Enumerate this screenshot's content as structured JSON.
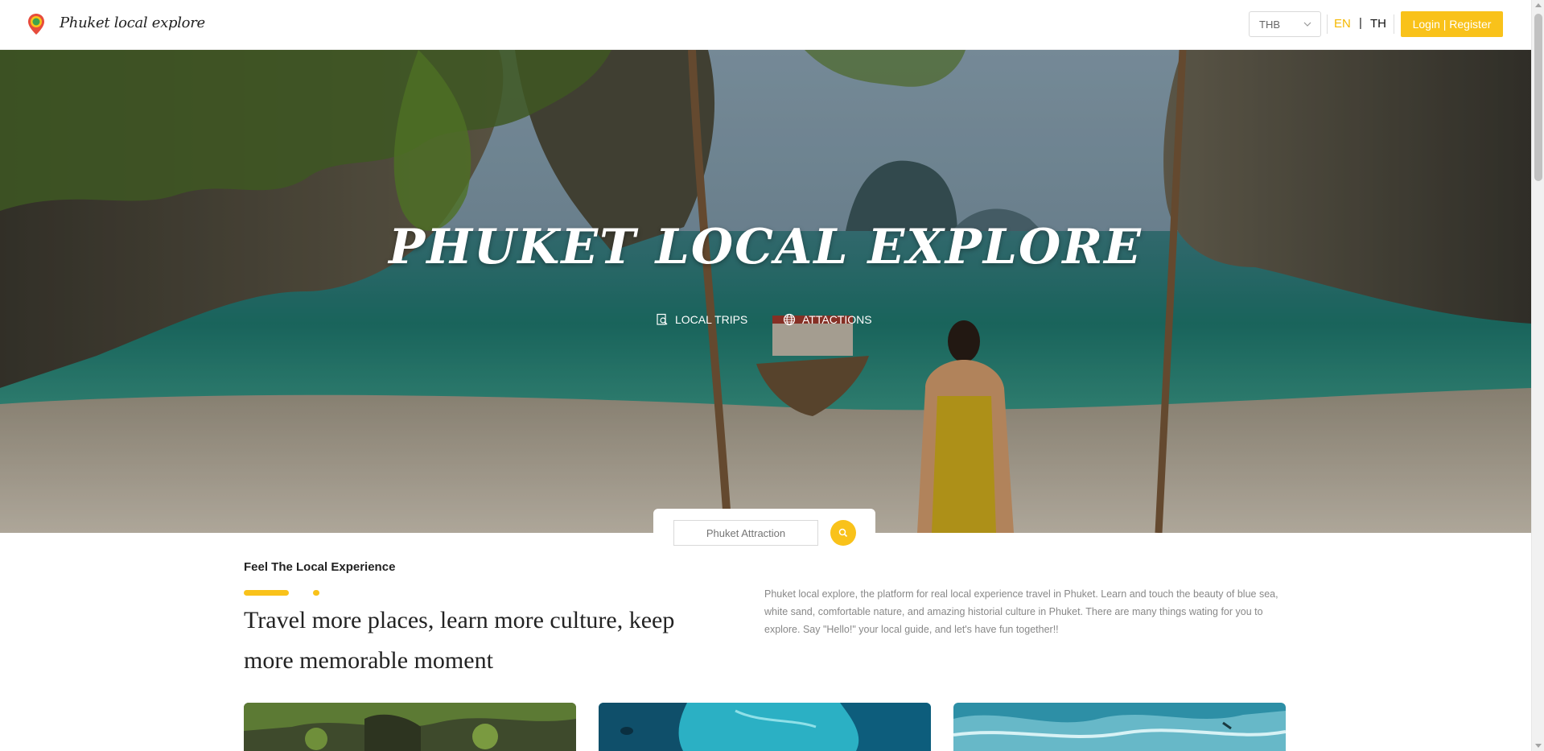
{
  "header": {
    "logo_text": "Phuket local explore",
    "currency": "THB",
    "lang_en": "EN",
    "lang_separator": "|",
    "lang_th": "TH",
    "login_label": "Login | Register"
  },
  "hero": {
    "title": "PHUKET LOCAL EXPLORE",
    "links": [
      {
        "label": "LOCAL TRIPS",
        "icon": "search-document-icon"
      },
      {
        "label": "ATTACTIONS",
        "icon": "globe-icon"
      }
    ]
  },
  "search": {
    "placeholder": "Phuket Attraction",
    "button_icon": "search-icon"
  },
  "intro": {
    "eyebrow": "Feel The Local Experience",
    "headline": "Travel more places, learn more culture, keep more memorable moment",
    "description": "Phuket local explore, the platform for real local experience travel in Phuket. Learn and touch the beauty of blue sea, white sand, comfortable nature, and amazing historial culture in Phuket. There are many things wating for you to explore. Say \"Hello!\" your local guide, and let's have fun together!!"
  },
  "colors": {
    "accent": "#f9c21a",
    "text_dark": "#222222",
    "text_muted": "#888888"
  }
}
